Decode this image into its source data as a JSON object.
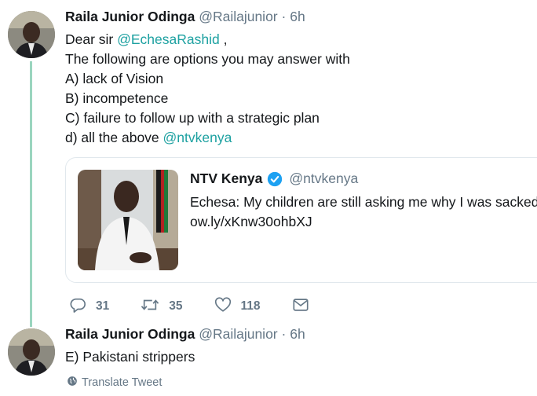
{
  "tweet1": {
    "name": "Raila Junior Odinga",
    "handle": "@Railajunior",
    "dot": "·",
    "time": "6h",
    "line1_pre": "Dear sir ",
    "line1_mention": "@EchesaRashid",
    "line1_post": " ,",
    "line2": "The following are options you may answer with",
    "line3": "A) lack of Vision",
    "line4": "B) incompetence",
    "line5": "C) failure to follow up with a strategic plan",
    "line6_pre": "d) all the above ",
    "line6_mention": "@ntvkenya"
  },
  "quote": {
    "name": "NTV Kenya",
    "handle": "@ntvkenya",
    "text": "Echesa: My children are still asking me why I was sacked",
    "link": "ow.ly/xKnw30ohbXJ"
  },
  "actions": {
    "replies": "31",
    "retweets": "35",
    "likes": "118"
  },
  "tweet2": {
    "name": "Raila Junior Odinga",
    "handle": "@Railajunior",
    "dot": "·",
    "time": "6h",
    "text": "E) Pakistani strippers",
    "translate": "Translate Tweet"
  },
  "colors": {
    "mention": "#1da1a1",
    "thread_line": "#9ad5bf",
    "secondary_text": "#657786",
    "verified": "#1da1f2"
  },
  "icons": [
    "reply-icon",
    "retweet-icon",
    "like-icon",
    "message-icon",
    "verified-badge-icon",
    "globe-icon"
  ]
}
